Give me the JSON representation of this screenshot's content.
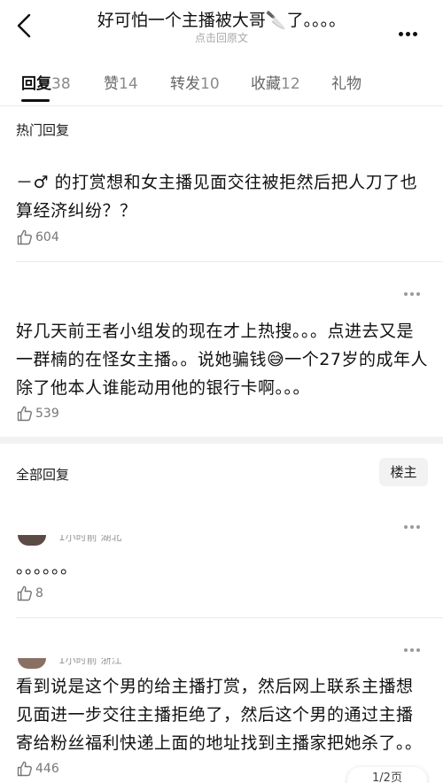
{
  "header": {
    "title": "好可怕一个主播被大哥🔪了。。。。",
    "subtitle": "点击回原文"
  },
  "tabs": [
    {
      "label": "回复",
      "count": "38"
    },
    {
      "label": "赞",
      "count": "14"
    },
    {
      "label": "转发",
      "count": "10"
    },
    {
      "label": "收藏",
      "count": "12"
    },
    {
      "label": "礼物",
      "count": ""
    }
  ],
  "hot_section": {
    "title": "热门回复",
    "replies": [
      {
        "text": "－♂ 的打赏想和女主播见面交往被拒然后把人刀了也算经济纠纷？？",
        "likes": "604"
      },
      {
        "text": "好几天前王者小组发的现在才上热搜。。。点进去又是一群楠的在怪女主播。。说她骗钱😅一个27岁的成年人除了他本人谁能动用他的银行卡啊。。。",
        "likes": "539"
      }
    ]
  },
  "all_section": {
    "title": "全部回复",
    "filter_button": "楼主",
    "replies": [
      {
        "meta": "1小时前 湖北",
        "text": "。。。。。。",
        "likes": "8"
      },
      {
        "meta": "1小时前 浙江",
        "text": "看到说是这个男的给主播打赏，然后网上联系主播想见面进一步交往主播拒绝了，然后这个男的通过主播寄给粉丝福利快递上面的地址找到主播家把她杀了。。",
        "likes": "446"
      }
    ]
  },
  "page_indicator": "1/2页"
}
